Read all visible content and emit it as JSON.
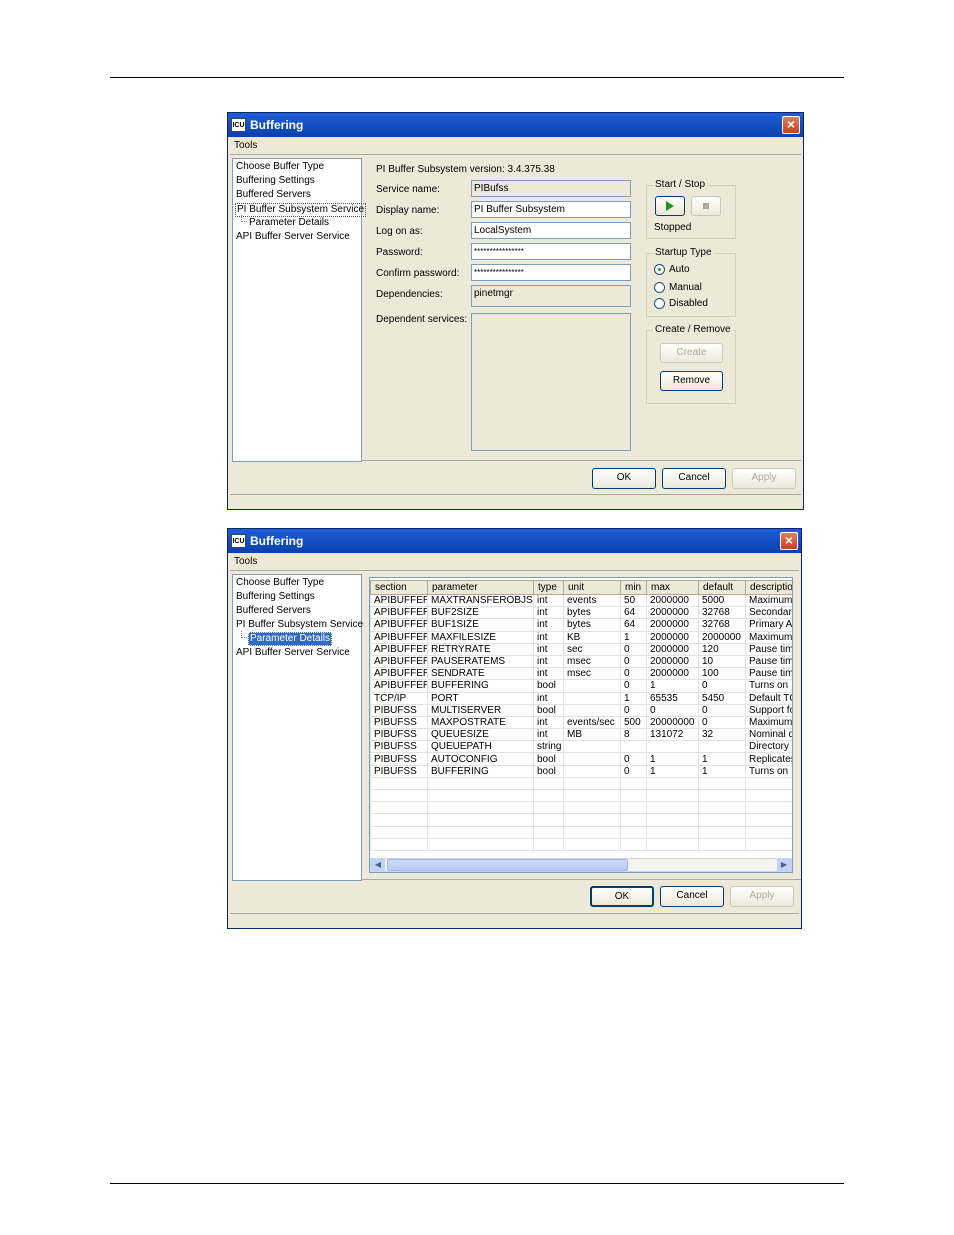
{
  "window1": {
    "title": "Buffering",
    "menu": "Tools",
    "tree": [
      "Choose Buffer Type",
      "Buffering Settings",
      "Buffered Servers",
      "PI Buffer Subsystem Service",
      "Parameter Details",
      "API Buffer Server Service"
    ],
    "version": "PI Buffer Subsystem version: 3.4.375.38",
    "labels": {
      "service_name": "Service name:",
      "display_name": "Display name:",
      "log_on_as": "Log on as:",
      "password": "Password:",
      "confirm_password": "Confirm password:",
      "dependencies": "Dependencies:",
      "dependent_services": "Dependent services:"
    },
    "values": {
      "service_name": "PIBufss",
      "display_name": "PI Buffer Subsystem",
      "log_on_as": "LocalSystem",
      "password": "****************",
      "confirm_password": "****************",
      "dependencies": "pinetmgr"
    },
    "start_stop": {
      "title": "Start / Stop",
      "status": "Stopped"
    },
    "startup_type": {
      "title": "Startup Type",
      "options": [
        "Auto",
        "Manual",
        "Disabled"
      ],
      "selected": "Auto"
    },
    "create_remove": {
      "title": "Create / Remove",
      "create": "Create",
      "remove": "Remove"
    },
    "buttons": {
      "ok": "OK",
      "cancel": "Cancel",
      "apply": "Apply"
    }
  },
  "window2": {
    "title": "Buffering",
    "menu": "Tools",
    "tree": [
      "Choose Buffer Type",
      "Buffering Settings",
      "Buffered Servers",
      "PI Buffer Subsystem Service",
      "Parameter Details",
      "API Buffer Server Service"
    ],
    "selected_tree_item": "Parameter Details",
    "columns": [
      "section",
      "parameter",
      "type",
      "unit",
      "min",
      "max",
      "default",
      "descriptio"
    ],
    "rows": [
      [
        "APIBUFFER",
        "MAXTRANSFEROBJS",
        "int",
        "events",
        "50",
        "2000000",
        "5000",
        "Maximum"
      ],
      [
        "APIBUFFER",
        "BUF2SIZE",
        "int",
        "bytes",
        "64",
        "2000000",
        "32768",
        "Secondar"
      ],
      [
        "APIBUFFER",
        "BUF1SIZE",
        "int",
        "bytes",
        "64",
        "2000000",
        "32768",
        "Primary AP"
      ],
      [
        "APIBUFFER",
        "MAXFILESIZE",
        "int",
        "KB",
        "1",
        "2000000",
        "2000000",
        "Maximum"
      ],
      [
        "APIBUFFER",
        "RETRYRATE",
        "int",
        "sec",
        "0",
        "2000000",
        "120",
        "Pause tim"
      ],
      [
        "APIBUFFER",
        "PAUSERATEMS",
        "int",
        "msec",
        "0",
        "2000000",
        "10",
        "Pause tim"
      ],
      [
        "APIBUFFER",
        "SENDRATE",
        "int",
        "msec",
        "0",
        "2000000",
        "100",
        "Pause tim"
      ],
      [
        "APIBUFFER",
        "BUFFERING",
        "bool",
        "",
        "0",
        "1",
        "0",
        "Turns on"
      ],
      [
        "TCP/IP",
        "PORT",
        "int",
        "",
        "1",
        "65535",
        "5450",
        "Default TC"
      ],
      [
        "PIBUFSS",
        "MULTISERVER",
        "bool",
        "",
        "0",
        "0",
        "0",
        "Support fo"
      ],
      [
        "PIBUFSS",
        "MAXPOSTRATE",
        "int",
        "events/sec",
        "500",
        "20000000",
        "0",
        "Maximum"
      ],
      [
        "PIBUFSS",
        "QUEUESIZE",
        "int",
        "MB",
        "8",
        "131072",
        "32",
        "Nominal d"
      ],
      [
        "PIBUFSS",
        "QUEUEPATH",
        "string",
        "",
        "",
        "",
        "",
        "Directory p"
      ],
      [
        "PIBUFSS",
        "AUTOCONFIG",
        "bool",
        "",
        "0",
        "1",
        "1",
        "Replicates"
      ],
      [
        "PIBUFSS",
        "BUFFERING",
        "bool",
        "",
        "0",
        "1",
        "1",
        "Turns on"
      ]
    ],
    "buttons": {
      "ok": "OK",
      "cancel": "Cancel",
      "apply": "Apply"
    }
  }
}
